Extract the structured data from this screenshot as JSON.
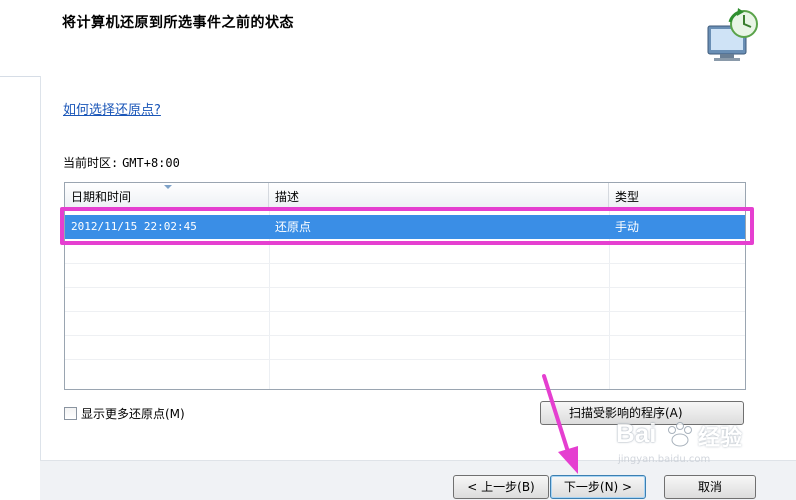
{
  "header": {
    "title": "将计算机还原到所选事件之前的状态",
    "icon": "system-restore-icon"
  },
  "help_link": "如何选择还原点?",
  "timezone": {
    "label": "当前时区:",
    "value": "GMT+8:00"
  },
  "table": {
    "columns": [
      "日期和时间",
      "描述",
      "类型"
    ],
    "rows": [
      {
        "date": "2012/11/15 22:02:45",
        "description": "还原点",
        "type": "手动",
        "selected": true
      }
    ],
    "selected_color": "#3a8ee6"
  },
  "show_more": {
    "label": "显示更多还原点(M)",
    "checked": false
  },
  "buttons": {
    "scan": "扫描受影响的程序(A)",
    "back": "< 上一步(B)",
    "next": "下一步(N) >",
    "cancel": "取消"
  },
  "annotation": {
    "highlight_color": "#e53fd0",
    "arrow_color": "#e53fd0"
  },
  "watermark": {
    "brand": "Bai",
    "brand2": "经验",
    "url": "jingyan.baidu.com"
  }
}
